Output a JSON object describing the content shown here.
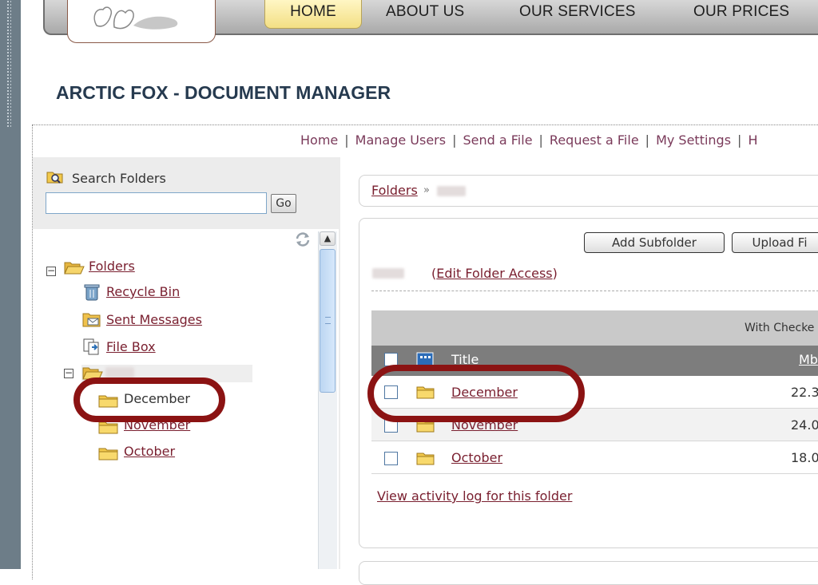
{
  "nav": {
    "items": [
      "HOME",
      "ABOUT US",
      "OUR SERVICES",
      "OUR PRICES"
    ],
    "active": "HOME"
  },
  "page_title": "ARCTIC FOX - DOCUMENT MANAGER",
  "top_links": [
    "Home",
    "Manage Users",
    "Send a File",
    "Request a File",
    "My Settings",
    "H"
  ],
  "search": {
    "label": "Search Folders",
    "value": "",
    "go_label": "Go"
  },
  "tree": {
    "root": "Folders",
    "items": [
      "Recycle Bin",
      "Sent Messages",
      "File Box"
    ],
    "subfolders": [
      "December",
      "November",
      "October"
    ]
  },
  "breadcrumb": {
    "root": "Folders",
    "separator": "»"
  },
  "actions": {
    "add_subfolder": "Add Subfolder",
    "upload": "Upload Fi",
    "edit_access": "Edit Folder Access",
    "edit_access_open": "(",
    "edit_access_close": ")"
  },
  "table": {
    "checked_out_label": "With Checke",
    "headers": {
      "title": "Title",
      "size": "Mb"
    },
    "rows": [
      {
        "title": "December",
        "size": "22.3"
      },
      {
        "title": "November",
        "size": "24.0"
      },
      {
        "title": "October",
        "size": "18.0"
      }
    ]
  },
  "activity_link": "View activity log for this folder",
  "colors": {
    "link": "#7a2030",
    "title": "#263a4f",
    "highlight": "#8b1313",
    "nav_active": "#f3df84"
  }
}
